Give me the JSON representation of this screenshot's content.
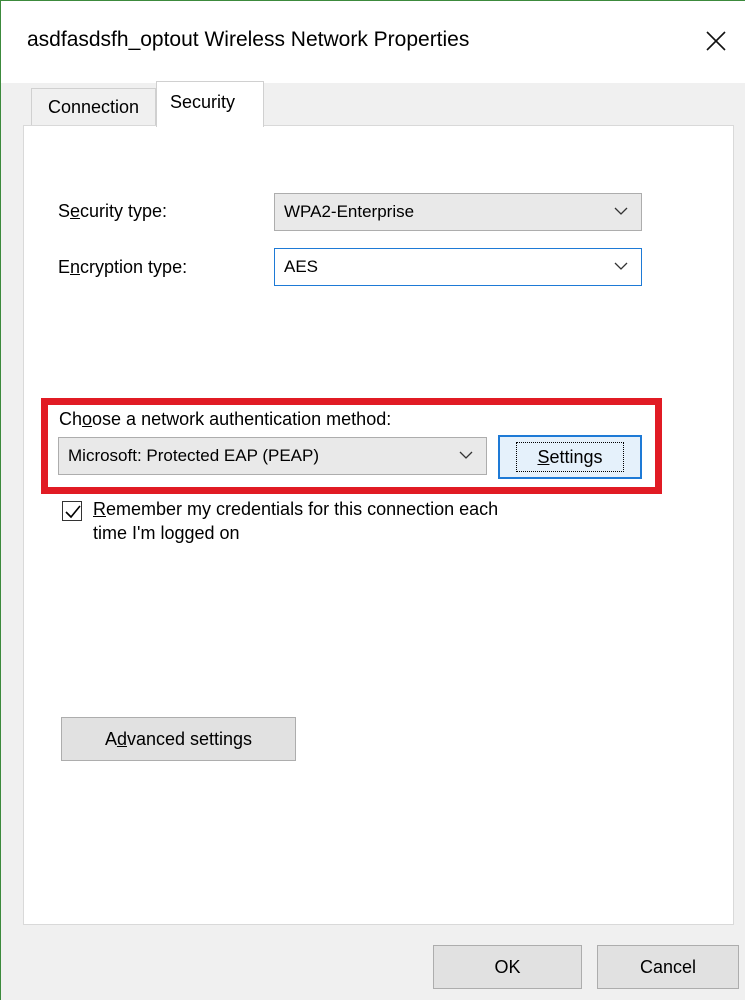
{
  "window": {
    "title": "asdfasdsfh_optout Wireless Network Properties"
  },
  "tabs": [
    {
      "label": "Connection",
      "active": false
    },
    {
      "label": "Security",
      "active": true
    }
  ],
  "security_type": {
    "label_pre": "S",
    "label_u": "e",
    "label_post": "curity type:",
    "value": "WPA2-Enterprise"
  },
  "encryption_type": {
    "label_pre": "E",
    "label_u": "n",
    "label_post": "cryption type:",
    "value": "AES"
  },
  "auth_method": {
    "label_pre": "Ch",
    "label_u": "o",
    "label_post": "ose a network authentication method:",
    "value": "Microsoft: Protected EAP (PEAP)",
    "settings_u": "S",
    "settings_post": "ettings"
  },
  "remember_credentials": {
    "checked": true,
    "text_u": "R",
    "text_line1": "emember my credentials for this connection each",
    "text_line2": "time I'm logged on"
  },
  "advanced": {
    "label_pre": "A",
    "label_u": "d",
    "label_post": "vanced settings"
  },
  "footer": {
    "ok_label": "OK",
    "cancel_label": "Cancel"
  },
  "colors": {
    "highlight_border": "#e11b24",
    "focus_blue": "#1e7ad6",
    "window_edge": "#3c8a3c"
  },
  "icons": {
    "close": "close-icon",
    "dropdown": "chevron-down-icon",
    "check": "checkmark-icon"
  }
}
